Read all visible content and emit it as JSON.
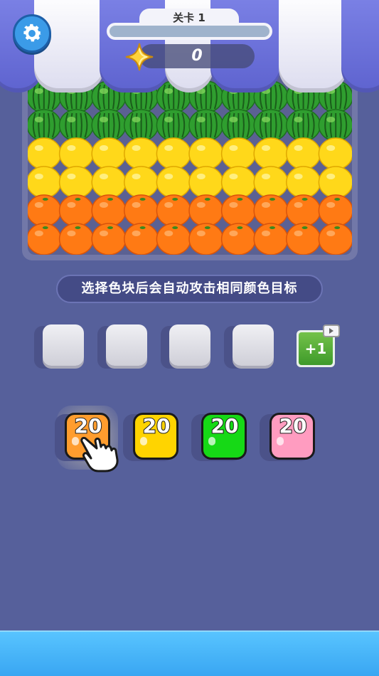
{
  "header": {
    "level_label": "关卡 1",
    "level_progress": 0,
    "score": "0"
  },
  "board": {
    "rows": [
      "watermelon",
      "watermelon",
      "lemon",
      "lemon",
      "orange",
      "orange"
    ],
    "columns": 10
  },
  "hint": {
    "text": "选择色块后会自动攻击相同颜色目标"
  },
  "slots": {
    "empty_count": 4,
    "add_label": "+1"
  },
  "blocks": [
    {
      "color_name": "orange",
      "color": "#ff9d2e",
      "count": "20",
      "selected": true
    },
    {
      "color_name": "yellow",
      "color": "#ffd400",
      "count": "20",
      "selected": false
    },
    {
      "color_name": "green",
      "color": "#16d916",
      "count": "20",
      "selected": false
    },
    {
      "color_name": "pink",
      "color": "#ff9cc0",
      "count": "20",
      "selected": false
    }
  ],
  "icons": {
    "settings": "gear-icon",
    "score": "star-icon",
    "add_slot_badge": "video-icon",
    "pointer": "hand-pointer-icon"
  },
  "colors": {
    "background": "#56609b",
    "bottom_bar": "#39a6f2",
    "awning_blue": "#6c72dc"
  }
}
